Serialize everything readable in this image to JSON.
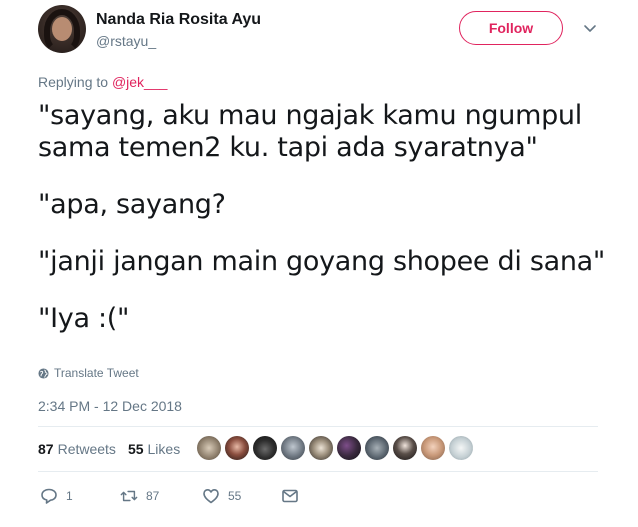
{
  "user": {
    "display_name": "Nanda Ria Rosita Ayu",
    "handle": "@rstayu_"
  },
  "follow_label": "Follow",
  "reply": {
    "prefix": "Replying to ",
    "mention": "@jek___"
  },
  "tweet_lines": [
    "\"sayang, aku mau ngajak kamu ngumpul",
    "sama temen2 ku. tapi ada syaratnya\"",
    "\"apa, sayang?",
    "\"janji jangan main goyang shopee di sana\"",
    "\"Iya :(\""
  ],
  "translate_label": "Translate Tweet",
  "timestamp": "2:34 PM - 12 Dec 2018",
  "stats": {
    "retweets_count": "87",
    "retweets_label": "Retweets",
    "likes_count": "55",
    "likes_label": "Likes"
  },
  "actions": {
    "reply_count": "1",
    "retweet_count": "87",
    "like_count": "55"
  },
  "colors": {
    "accent": "#e0245e",
    "secondary_text": "#657786",
    "primary_text": "#14171a",
    "divider": "#e6ecf0"
  },
  "icons": {
    "caret": "chevron-down-icon",
    "translate": "globe-icon",
    "reply": "reply-icon",
    "retweet": "retweet-icon",
    "like": "heart-icon",
    "message": "envelope-icon"
  }
}
